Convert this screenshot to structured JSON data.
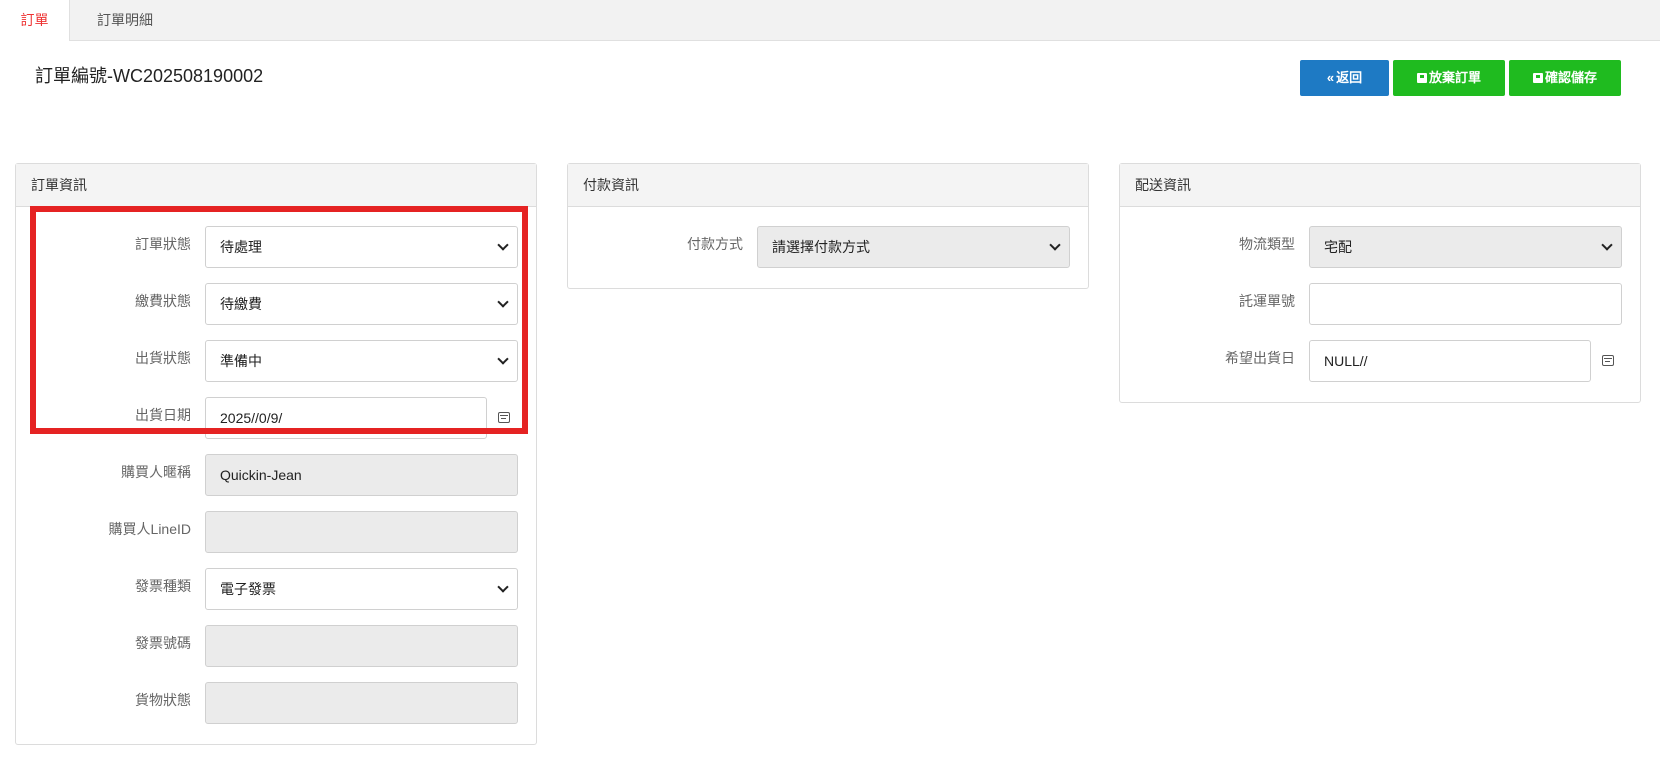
{
  "tabs": [
    {
      "label": "訂單",
      "active": true
    },
    {
      "label": "訂單明細",
      "active": false
    }
  ],
  "page_title": "訂單編號-WC202508190002",
  "toolbar": {
    "back_label": "返回",
    "abandon_label": "放棄訂單",
    "save_label": "確認儲存",
    "back_color": "#1e7ac4",
    "action_color": "#1fbb1f"
  },
  "order_panel": {
    "title": "訂單資訊",
    "fields": {
      "order_status": {
        "label": "訂單狀態",
        "value": "待處理"
      },
      "payment_status": {
        "label": "繳費狀態",
        "value": "待繳費"
      },
      "shipping_status": {
        "label": "出貨狀態",
        "value": "準備中"
      },
      "ship_date": {
        "label": "出貨日期",
        "value": "2025//0/9/"
      },
      "buyer_nickname": {
        "label": "購買人暱稱",
        "value": "Quickin-Jean"
      },
      "buyer_line_id": {
        "label": "購買人LineID",
        "value": ""
      },
      "invoice_type": {
        "label": "發票種類",
        "value": "電子發票"
      },
      "invoice_number": {
        "label": "發票號碼",
        "value": ""
      },
      "goods_status": {
        "label": "貨物狀態",
        "value": ""
      }
    }
  },
  "payment_panel": {
    "title": "付款資訊",
    "fields": {
      "payment_method": {
        "label": "付款方式",
        "value": "請選擇付款方式"
      }
    }
  },
  "delivery_panel": {
    "title": "配送資訊",
    "fields": {
      "logistics_type": {
        "label": "物流類型",
        "value": "宅配"
      },
      "tracking_number": {
        "label": "託運單號",
        "value": ""
      },
      "preferred_ship_date": {
        "label": "希望出貨日",
        "value": "NULL//"
      }
    }
  },
  "highlight_color": "#e52323"
}
